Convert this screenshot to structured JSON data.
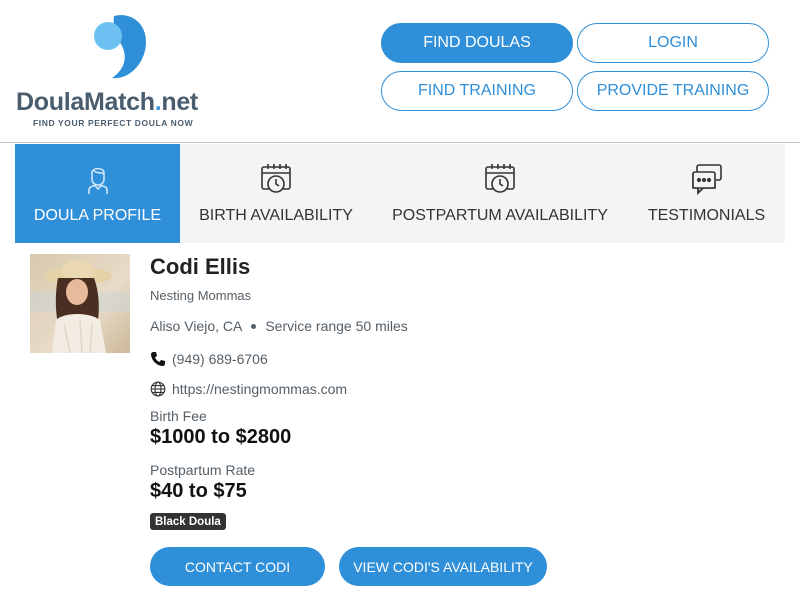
{
  "brand": {
    "name_main": "DoulaMatch",
    "name_dot": ".",
    "name_tld": "net",
    "tagline": "FIND YOUR PERFECT DOULA NOW",
    "colors": {
      "primary": "#2f8fd8",
      "logo_text": "#4a5d6e",
      "logo_light": "#6cc0f2"
    }
  },
  "nav": {
    "find_doulas": "FIND DOULAS",
    "login": "LOGIN",
    "find_training": "FIND TRAINING",
    "provide_training": "PROVIDE TRAINING"
  },
  "tabs": [
    {
      "label": "DOULA PROFILE",
      "icon": "doula-profile-icon",
      "active": true
    },
    {
      "label": "BIRTH AVAILABILITY",
      "icon": "calendar-clock-icon",
      "active": false
    },
    {
      "label": "POSTPARTUM AVAILABILITY",
      "icon": "calendar-clock-icon",
      "active": false
    },
    {
      "label": "TESTIMONIALS",
      "icon": "chat-bubbles-icon",
      "active": false
    }
  ],
  "profile": {
    "name": "Codi Ellis",
    "agency": "Nesting Mommas",
    "location": "Aliso Viejo, CA",
    "service_range": "Service range 50 miles",
    "phone": "(949) 689-6706",
    "website": "https://nestingmommas.com",
    "birth_fee_label": "Birth Fee",
    "birth_fee": "$1000 to $2800",
    "postpartum_label": "Postpartum Rate",
    "postpartum_rate": "$40 to $75",
    "badge": "Black Doula",
    "contact_button": "CONTACT CODI",
    "availability_button": "VIEW CODI'S AVAILABILITY"
  }
}
